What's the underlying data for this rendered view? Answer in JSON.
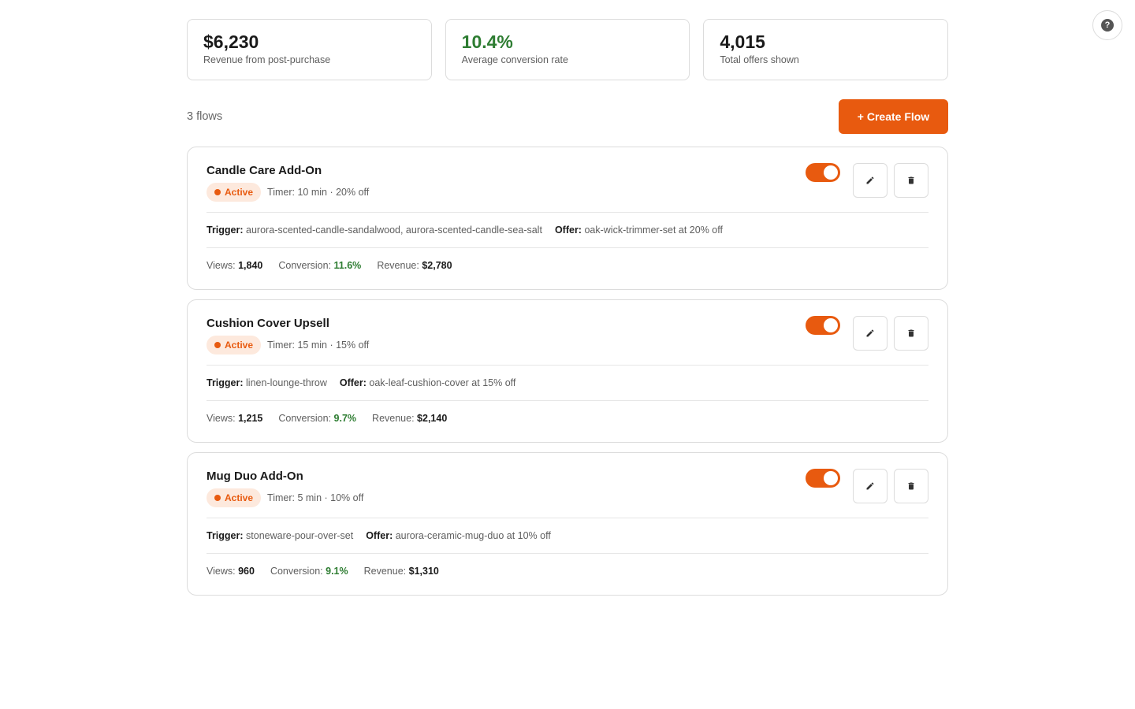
{
  "help": {
    "icon": "question-icon",
    "glyph": "?"
  },
  "stats": [
    {
      "value": "$6,230",
      "label": "Revenue from post-purchase"
    },
    {
      "value": "10.4%",
      "label": "Average conversion rate",
      "color": "#2e7d32"
    },
    {
      "value": "4,015",
      "label": "Total offers shown"
    }
  ],
  "toolbar": {
    "flow_count": "3 flows",
    "create_label": "+ Create Flow"
  },
  "labels": {
    "trigger": "Trigger:",
    "offer": "Offer:",
    "views": "Views:",
    "conversion": "Conversion:",
    "revenue": "Revenue:"
  },
  "flows": [
    {
      "name": "Candle Care Add-On",
      "status": "Active",
      "timer": "Timer: 10 min · 20% off",
      "trigger": "aurora-scented-candle-sandalwood, aurora-scented-candle-sea-salt",
      "offer": "oak-wick-trimmer-set at 20% off",
      "views": "1,840",
      "conversion": "11.6%",
      "revenue": "$2,780",
      "enabled": true
    },
    {
      "name": "Cushion Cover Upsell",
      "status": "Active",
      "timer": "Timer: 15 min · 15% off",
      "trigger": "linen-lounge-throw",
      "offer": "oak-leaf-cushion-cover at 15% off",
      "views": "1,215",
      "conversion": "9.7%",
      "revenue": "$2,140",
      "enabled": true
    },
    {
      "name": "Mug Duo Add-On",
      "status": "Active",
      "timer": "Timer: 5 min · 10% off",
      "trigger": "stoneware-pour-over-set",
      "offer": "aurora-ceramic-mug-duo at 10% off",
      "views": "960",
      "conversion": "9.1%",
      "revenue": "$1,310",
      "enabled": true
    }
  ],
  "colors": {
    "accent": "#e85a0f",
    "success": "#2e7d32",
    "badge_bg": "#fde9dd"
  }
}
